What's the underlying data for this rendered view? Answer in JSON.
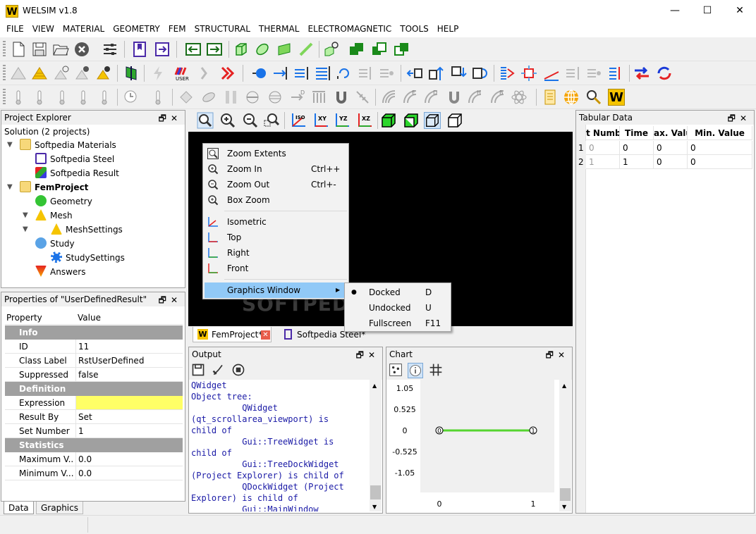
{
  "window": {
    "title": "WELSIM v1.8",
    "logo_letter": "W",
    "minimize": "—",
    "maximize": "☐",
    "close": "✕"
  },
  "menubar": [
    "FILE",
    "VIEW",
    "MATERIAL",
    "GEOMETRY",
    "FEM",
    "STRUCTURAL",
    "THERMAL",
    "ELECTROMAGNETIC",
    "TOOLS",
    "HELP"
  ],
  "project_explorer": {
    "title": "Project Explorer",
    "solution": "Solution (2 projects)",
    "materials_folder": "Softpedia Materials",
    "material_steel": "Softpedia Steel",
    "material_result": "Softpedia Result",
    "fem_project": "FemProject",
    "geometry": "Geometry",
    "mesh": "Mesh",
    "mesh_settings": "MeshSettings",
    "study": "Study",
    "study_settings": "StudySettings",
    "answers": "Answers"
  },
  "properties": {
    "title": "Properties of \"UserDefinedResult\"",
    "col_property": "Property",
    "col_value": "Value",
    "group_info": "Info",
    "id_label": "ID",
    "id_value": "11",
    "class_label": "Class Label",
    "class_value": "RstUserDefined",
    "suppressed_label": "Suppressed",
    "suppressed_value": "false",
    "group_definition": "Definition",
    "expression_label": "Expression",
    "expression_value": "",
    "result_by_label": "Result By",
    "result_by_value": "Set",
    "set_number_label": "Set Number",
    "set_number_value": "1",
    "group_statistics": "Statistics",
    "max_label": "Maximum V...",
    "max_value": "0.0",
    "min_label": "Minimum V...",
    "min_value": "0.0",
    "tab_data": "Data",
    "tab_graphics": "Graphics"
  },
  "context_menu": {
    "zoom_extents": "Zoom Extents",
    "zoom_in": "Zoom In",
    "zoom_in_key": "Ctrl++",
    "zoom_out": "Zoom Out",
    "zoom_out_key": "Ctrl+-",
    "box_zoom": "Box Zoom",
    "isometric": "Isometric",
    "top": "Top",
    "right": "Right",
    "front": "Front",
    "graphics_window": "Graphics Window",
    "submenu_arrow": "▶"
  },
  "submenu": {
    "docked": "Docked",
    "docked_key": "D",
    "bullet": "●",
    "undocked": "Undocked",
    "undocked_key": "U",
    "fullscreen": "Fullscreen",
    "fullscreen_key": "F11"
  },
  "doc_tabs": {
    "fem_project": "FemProject*",
    "softpedia_steel": "Softpedia Steel*"
  },
  "watermark": "SOFTPEDIA",
  "tabular": {
    "title": "Tabular Data",
    "headers": [
      "t Numb",
      "Time",
      "ax. Valu",
      "Min. Value"
    ],
    "rows": [
      {
        "index": "1",
        "cells": [
          "0",
          "0",
          "0",
          "0"
        ]
      },
      {
        "index": "2",
        "cells": [
          "1",
          "1",
          "0",
          "0"
        ]
      }
    ]
  },
  "output": {
    "title": "Output",
    "text": "QWidget\nObject tree:\n          QWidget\n(qt_scrollarea_viewport) is\nchild of\n          Gui::TreeWidget is\nchild of\n          Gui::TreeDockWidget\n(Project Explorer) is child of\n          QDockWidget (Project\nExplorer) is child of\n          Gui::MainWindow"
  },
  "chart": {
    "title": "Chart"
  },
  "chart_data": {
    "type": "line",
    "x": [
      0,
      1
    ],
    "series": [
      {
        "values": [
          0,
          0
        ]
      }
    ],
    "point_labels": [
      "0",
      "1"
    ],
    "yticks": [
      "1.05",
      "0.525",
      "0",
      "-0.525",
      "-1.05"
    ],
    "xticks": [
      "0",
      "1"
    ],
    "ylim": [
      -1.05,
      1.05
    ],
    "xlim": [
      0,
      1
    ],
    "line_color": "#55d52f"
  },
  "colors": {
    "accent_yellow": "#f5c400",
    "menu_highlight": "#91c9f7",
    "expression_bg": "#ffff66",
    "output_text": "#1a1aa6"
  }
}
